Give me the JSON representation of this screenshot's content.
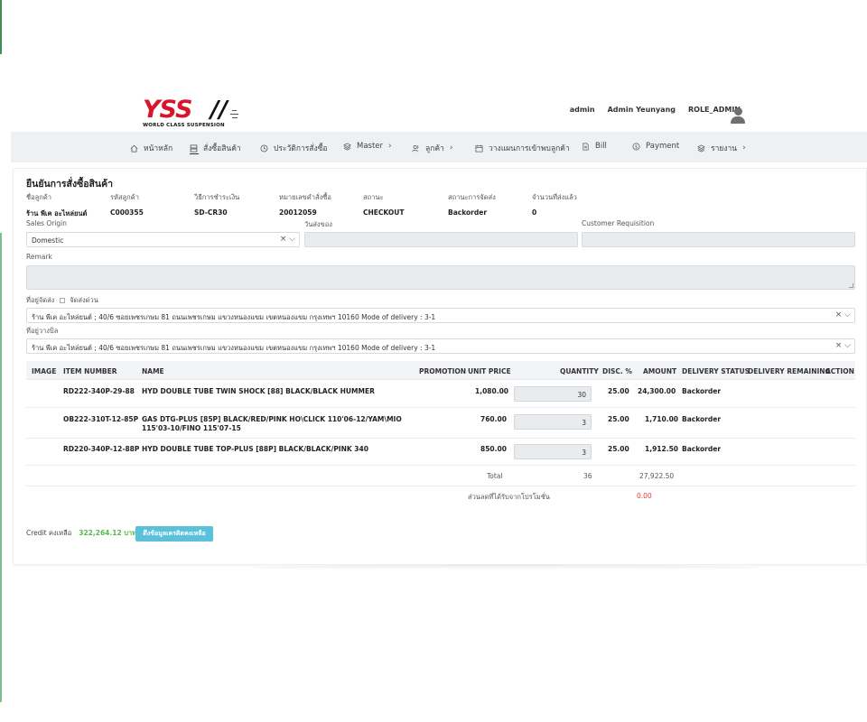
{
  "header": {
    "logo_text": "YSS",
    "logo_tagline": "WORLD CLASS SUSPENSION",
    "username": "admin",
    "full_name": "Admin Yeunyang",
    "role": "ROLE_ADMIN"
  },
  "nav": {
    "items": [
      {
        "label": "หน้าหลัก",
        "icon": "home-icon"
      },
      {
        "label": "สั่งซื้อสินค้า",
        "icon": "order-icon"
      },
      {
        "label": "ประวัติการสั่งซื้อ",
        "icon": "clock-icon"
      },
      {
        "label": "Master",
        "icon": "layers-icon"
      },
      {
        "label": "ลูกค้า",
        "icon": "users-icon"
      },
      {
        "label": "วางแผนการเข้าพบลูกค้า",
        "icon": "calendar-icon"
      },
      {
        "label": "Bill",
        "icon": "document-icon"
      },
      {
        "label": "Payment",
        "icon": "payment-icon"
      },
      {
        "label": "รายงาน",
        "icon": "layers-icon"
      }
    ]
  },
  "page": {
    "title": "ยืนยันการสั่งซื้อสินค้า",
    "info": [
      {
        "label": "ชื่อลูกค้า",
        "value": "ร้าน พีเค อะไหล่ยนต์"
      },
      {
        "label": "รหัสลูกค้า",
        "value": "C000355"
      },
      {
        "label": "วิธีการชำระเงิน",
        "value": "SD-CR30"
      },
      {
        "label": "หมายเลขคำสั่งซื้อ",
        "value": "20012059"
      },
      {
        "label": "สถานะ",
        "value": "CHECKOUT"
      },
      {
        "label": "สถานะการจัดส่ง",
        "value": "Backorder"
      },
      {
        "label": "จำนวนที่ส่งแล้ว",
        "value": "0"
      }
    ],
    "sales_origin_label": "Sales Origin",
    "sales_origin_value": "Domestic",
    "delivery_date_label": "วันส่งของ",
    "customer_requisition_label": "Customer Requisition",
    "remark_label": "Remark",
    "shipping_address_label": "ที่อยู่จัดส่ง",
    "urgent_label": "จัดส่งด่วน",
    "shipping_address_value": "ร้าน พีเค อะไหล่ยนต์ ; 40/6 ซอยเพชรเกษม 81 ถนนเพชรเกษม แขวงหนองแขม เขตหนองแขม กรุงเทพฯ 10160 Mode of delivery : 3-1",
    "billing_address_label": "ที่อยู่วางบิล",
    "billing_address_value": "ร้าน พีเค อะไหล่ยนต์ ; 40/6 ซอยเพชรเกษม 81 ถนนเพชรเกษม แขวงหนองแขม เขตหนองแขม กรุงเทพฯ 10160 Mode of delivery : 3-1"
  },
  "table": {
    "headers": [
      "IMAGE",
      "ITEM NUMBER",
      "NAME",
      "PROMOTION",
      "UNIT PRICE",
      "QUANTITY",
      "DISC. %",
      "AMOUNT",
      "DELIVERY STATUS",
      "DELIVERY REMAINING",
      "ACTION"
    ],
    "rows": [
      {
        "item": "RD222-340P-29-88",
        "name": "HYD DOUBLE TUBE TWIN SHOCK [88] BLACK/BLACK HUMMER",
        "unit_price": "1,080.00",
        "qty": "30",
        "disc": "25.00",
        "amount": "24,300.00",
        "status": "Backorder"
      },
      {
        "item": "OB222-310T-12-85P",
        "name": "GAS DTG-PLUS [85P] BLACK/RED/PINK HO\\CLICK 110'06-12/YAM\\MIO 115'03-10/FINO 115'07-15",
        "unit_price": "760.00",
        "qty": "3",
        "disc": "25.00",
        "amount": "1,710.00",
        "status": "Backorder"
      },
      {
        "item": "RD220-340P-12-88P",
        "name": "HYD DOUBLE TUBE TOP-PLUS [88P] BLACK/BLACK/PINK 340",
        "unit_price": "850.00",
        "qty": "3",
        "disc": "25.00",
        "amount": "1,912.50",
        "status": "Backorder"
      }
    ],
    "total_label": "Total",
    "total_qty": "36",
    "total_amount": "27,922.50",
    "promo_discount_label": "ส่วนลดที่ได้รับจากโปรโมชั่น",
    "promo_discount_value": "0.00"
  },
  "credit": {
    "label": "Credit คงเหลือ",
    "amount": "322,264.12 บาท",
    "button_label": "ดึงข้อมูลเครดิตคงเหลือ"
  },
  "colors": {
    "brand_red": "#d8152a",
    "credit_green": "#57b84a",
    "button_cyan": "#5bc0d9",
    "discount_red": "#e53935"
  }
}
